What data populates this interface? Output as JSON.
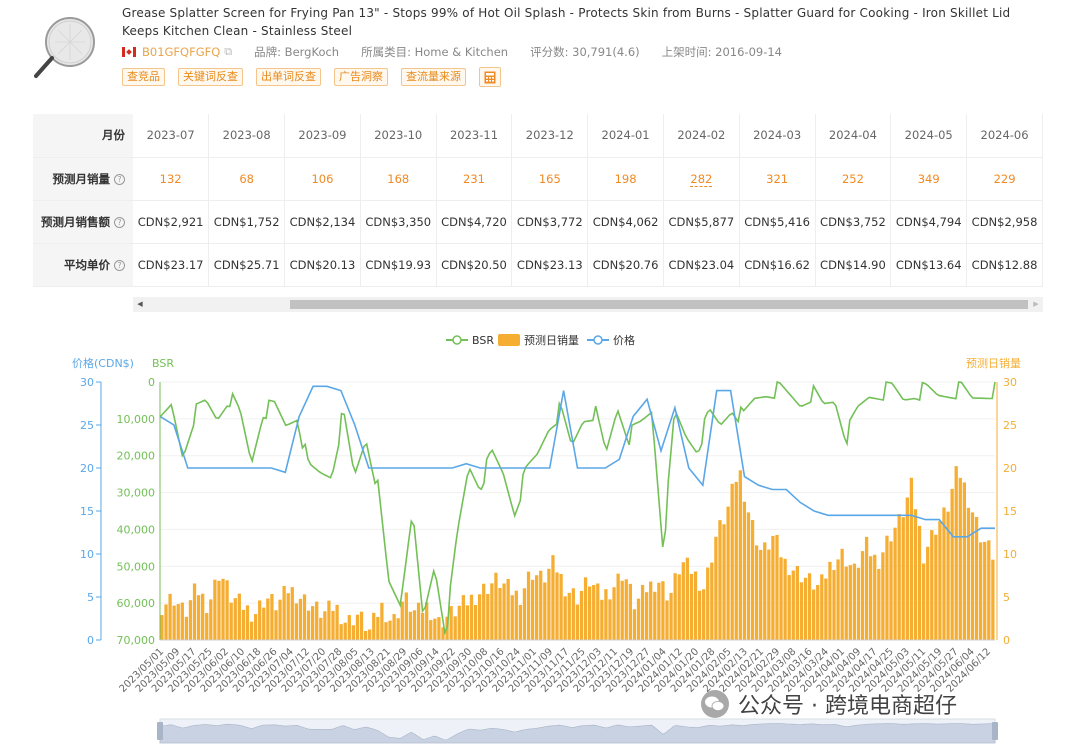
{
  "product": {
    "title": "Grease Splatter Screen for Frying Pan 13\" - Stops 99% of Hot Oil Splash - Protects Skin from Burns - Splatter Guard for Cooking - Iron Skillet Lid Keeps Kitchen Clean - Stainless Steel",
    "asin": "B01GFQFGFQ",
    "brand": "品牌: BergKoch",
    "category": "所属类目: Home & Kitchen",
    "rating": "评分数: 30,791(4.6)",
    "listed": "上架时间: 2016-09-14",
    "image_icon": "splatter-screen-image",
    "flag_icon": "canada-flag-icon"
  },
  "actions": [
    "查竞品",
    "关键词反查",
    "出单词反查",
    "广告洞察",
    "查流量来源"
  ],
  "table": {
    "month_label": "月份",
    "months": [
      "2023-07",
      "2023-08",
      "2023-09",
      "2023-10",
      "2023-11",
      "2023-12",
      "2024-01",
      "2024-02",
      "2024-03",
      "2024-04",
      "2024-05",
      "2024-06"
    ],
    "rows": [
      {
        "label": "预测月销量",
        "values": [
          "132",
          "68",
          "106",
          "168",
          "231",
          "165",
          "198",
          "282",
          "321",
          "252",
          "349",
          "229"
        ]
      },
      {
        "label": "预测月销售额",
        "values": [
          "CDN$2,921",
          "CDN$1,752",
          "CDN$2,134",
          "CDN$3,350",
          "CDN$4,720",
          "CDN$3,772",
          "CDN$4,062",
          "CDN$5,877",
          "CDN$5,416",
          "CDN$3,752",
          "CDN$4,794",
          "CDN$2,958"
        ]
      },
      {
        "label": "平均单价",
        "values": [
          "CDN$23.17",
          "CDN$25.71",
          "CDN$20.13",
          "CDN$19.93",
          "CDN$20.50",
          "CDN$23.13",
          "CDN$20.76",
          "CDN$23.04",
          "CDN$16.62",
          "CDN$14.90",
          "CDN$13.64",
          "CDN$12.88"
        ]
      }
    ],
    "help_icon": "?"
  },
  "chart_data": {
    "type": "line",
    "legend": [
      "BSR",
      "预测日销量",
      "价格"
    ],
    "legend_position": "top-center",
    "axes": {
      "price_title": "价格(CDN$)",
      "bsr_title": "BSR",
      "daily_title": "预测日销量",
      "price_ticks": [
        "30",
        "25",
        "20",
        "15",
        "10",
        "5",
        "0"
      ],
      "bsr_ticks": [
        "0",
        "10,000",
        "20,000",
        "30,000",
        "40,000",
        "50,000",
        "60,000",
        "70,000"
      ],
      "daily_ticks": [
        "30",
        "25",
        "20",
        "15",
        "10",
        "5",
        "0"
      ],
      "price_range": [
        0,
        30
      ],
      "bsr_range": [
        0,
        70000
      ],
      "daily_range": [
        0,
        30
      ]
    },
    "x_labels": [
      "2023/05/01",
      "2023/05/09",
      "2023/05/17",
      "2023/05/25",
      "2023/06/02",
      "2023/06/10",
      "2023/06/18",
      "2023/06/26",
      "2023/07/04",
      "2023/07/12",
      "2023/07/20",
      "2023/07/28",
      "2023/08/05",
      "2023/08/13",
      "2023/08/21",
      "2023/08/29",
      "2023/09/06",
      "2023/09/14",
      "2023/09/22",
      "2023/09/30",
      "2023/10/08",
      "2023/10/16",
      "2023/10/24",
      "2023/11/01",
      "2023/11/09",
      "2023/11/17",
      "2023/11/25",
      "2023/12/03",
      "2023/12/11",
      "2023/12/19",
      "2023/12/27",
      "2024/01/04",
      "2024/01/12",
      "2024/01/20",
      "2024/01/28",
      "2024/02/05",
      "2024/02/13",
      "2024/02/21",
      "2024/02/29",
      "2024/03/08",
      "2024/03/16",
      "2024/03/24",
      "2024/04/01",
      "2024/04/09",
      "2024/04/17",
      "2024/04/25",
      "2024/05/03",
      "2024/05/11",
      "2024/05/19",
      "2024/05/27",
      "2024/06/04",
      "2024/06/12"
    ],
    "series": [
      {
        "name": "BSR",
        "color": "#73c057",
        "values": [
          12000,
          7000,
          20000,
          9000,
          6000,
          10000,
          4000,
          9000,
          22000,
          8000,
          7000,
          12000,
          9000,
          24000,
          25000,
          25000,
          9000,
          26000,
          15000,
          28000,
          55000,
          60000,
          35000,
          65000,
          50000,
          68000,
          42000,
          23000,
          28000,
          20000,
          25000,
          35000,
          25000,
          20000,
          12000,
          8000,
          18000,
          10000,
          8000,
          20000,
          7000,
          15000,
          12000,
          8000,
          45000,
          9000,
          15000,
          18000,
          9000,
          12000,
          7000,
          10000,
          5000,
          3000,
          2000,
          4000,
          6000,
          3000,
          7000,
          5000,
          15000,
          8000,
          4000,
          3000,
          2000,
          5000,
          3000,
          2500,
          4000,
          3000,
          2000,
          5000,
          3500,
          2000
        ]
      },
      {
        "name": "预测日销量",
        "color": "#f5ad32",
        "values": [
          4,
          5,
          3,
          6,
          4,
          8,
          5,
          4,
          3,
          5,
          4,
          6,
          5,
          4,
          3,
          4,
          2,
          3,
          1,
          4,
          2,
          5,
          3,
          4,
          2,
          3,
          4,
          5,
          6,
          7,
          6,
          5,
          8,
          7,
          9,
          6,
          5,
          7,
          5,
          6,
          8,
          4,
          6,
          7,
          5,
          9,
          8,
          6,
          12,
          15,
          20,
          14,
          10,
          12,
          9,
          8,
          7,
          6,
          9,
          10,
          8,
          11,
          9,
          12,
          14,
          18,
          10,
          13,
          15,
          20,
          16,
          12,
          10
        ]
      },
      {
        "name": "价格",
        "color": "#5aa7e8",
        "values": [
          26,
          25,
          20,
          20,
          20,
          20,
          20,
          20,
          20,
          19.5,
          26,
          29.5,
          29.5,
          29,
          25,
          20,
          20,
          20,
          20,
          20,
          20,
          20,
          20.5,
          20,
          20,
          20,
          20,
          20,
          20,
          29,
          20,
          20,
          20,
          21,
          26,
          28,
          22,
          27,
          20,
          18,
          29,
          29,
          19,
          18,
          17.5,
          17.5,
          16,
          15,
          14.5,
          14.5,
          14.5,
          14.5,
          14.5,
          14.5,
          14.5,
          14,
          14,
          12,
          12,
          13,
          13
        ]
      }
    ]
  },
  "scrollbar": {
    "left_arrow": "◀",
    "right_arrow": "▶"
  },
  "watermark": {
    "text": "公众号 · 跨境电商超仔",
    "icon": "wechat-icon"
  }
}
